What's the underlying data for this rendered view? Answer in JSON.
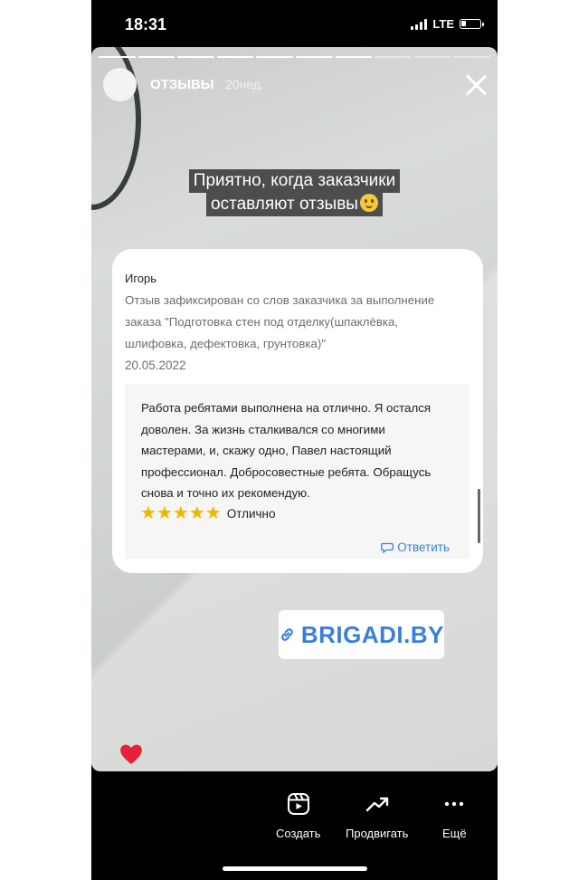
{
  "status": {
    "time": "18:31",
    "network": "LTE",
    "battery_level": 0.2
  },
  "story": {
    "account": "ОТЗЫВЫ",
    "age": "20нед.",
    "progress": {
      "total": 10,
      "completed": 7
    },
    "caption": {
      "line1": "Приятно, когда заказчики",
      "line2": "оставляют отзывы"
    },
    "liked": true
  },
  "review": {
    "reviewer": "Игорь",
    "note": "Отзыв зафиксирован со слов заказчика за выполнение заказа \"Подготовка стен под отделку(шпаклёвка, шлифовка, дефектовка, грунтовка)\"",
    "date": "20.05.2022",
    "text": "Работа ребятами выполнена на отлично. Я остался доволен. За жизнь сталкивался со многими мастерами, и,  скажу одно, Павел настоящий профессионал. Добросовестные ребята. Обращусь снова и точно их рекомендую.",
    "stars": 5,
    "rating_label": "Отлично",
    "reply_label": "Ответить"
  },
  "link": {
    "text": "BRIGADI.BY",
    "color": "#3a7fdc"
  },
  "nav": {
    "create": "Создать",
    "promote": "Продвигать",
    "more": "Ещё"
  },
  "colors": {
    "like": "#e8213a",
    "star": "#f4b400",
    "reply": "#3b7fd4"
  }
}
